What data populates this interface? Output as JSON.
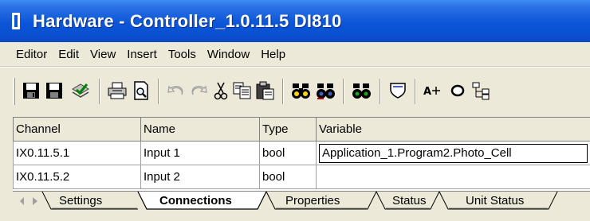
{
  "window": {
    "title": "Hardware - Controller_1.0.11.5  DI810",
    "icon": "hardware-app-icon"
  },
  "menu": [
    "Editor",
    "Edit",
    "View",
    "Insert",
    "Tools",
    "Window",
    "Help"
  ],
  "toolbar": {
    "icons": [
      "save-icon",
      "save-all-icon",
      "check-icon",
      "print-icon",
      "print-preview-icon",
      "undo-icon",
      "redo-icon",
      "cut-icon",
      "copy-icon",
      "paste-icon",
      "find-icon",
      "find-replace-icon",
      "find-in-project-icon",
      "shield-icon",
      "text-size-icon",
      "circle-icon",
      "tree-icon"
    ]
  },
  "grid": {
    "headers": [
      "Channel",
      "Name",
      "Type",
      "Variable"
    ],
    "rows": [
      [
        "IX0.11.5.1",
        "Input 1",
        "bool",
        "Application_1.Program2.Photo_Cell"
      ],
      [
        "IX0.11.5.2",
        "Input 2",
        "bool",
        ""
      ]
    ]
  },
  "tabs": [
    {
      "label": "Settings",
      "active": false
    },
    {
      "label": "Connections",
      "active": true
    },
    {
      "label": "Properties",
      "active": false
    },
    {
      "label": "Status",
      "active": false
    },
    {
      "label": "Unit Status",
      "active": false
    }
  ]
}
